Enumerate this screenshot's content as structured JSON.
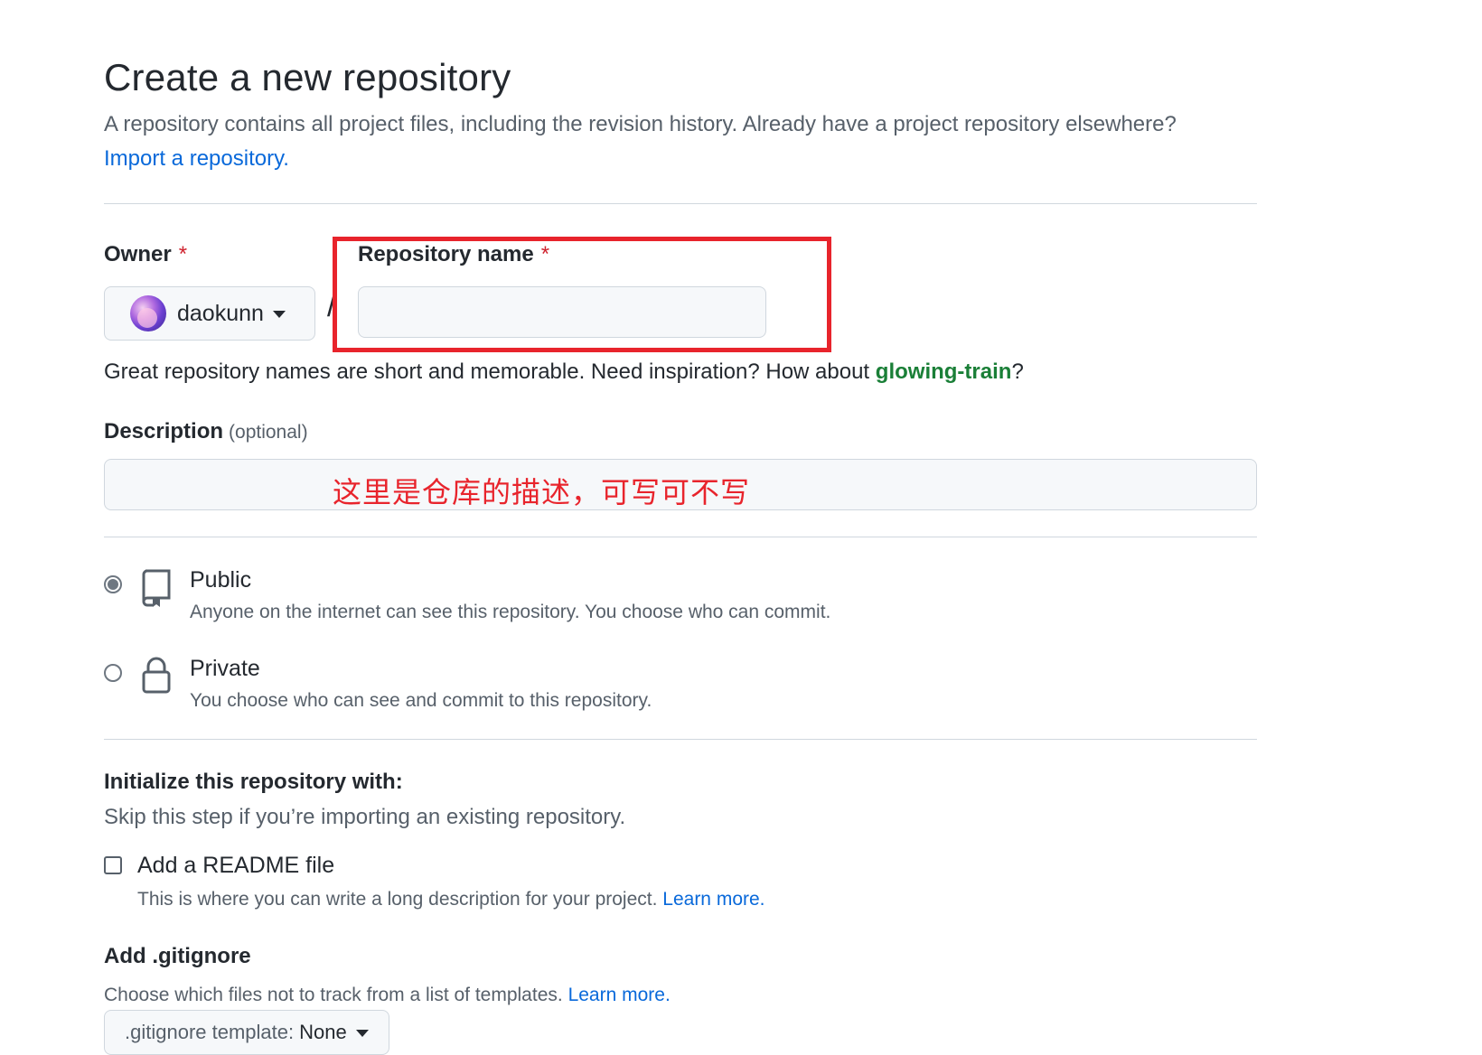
{
  "header": {
    "title": "Create a new repository",
    "subtitle": "A repository contains all project files, including the revision history. Already have a project repository elsewhere?",
    "import_link": "Import a repository."
  },
  "owner": {
    "label": "Owner",
    "required_mark": "*",
    "name": "daokunn",
    "avatar_icon": "user-avatar",
    "separator": "/"
  },
  "repo_name": {
    "label": "Repository name",
    "required_mark": "*",
    "value": "",
    "placeholder": ""
  },
  "name_hint": {
    "text": "Great repository names are short and memorable. Need inspiration? How about ",
    "suggestion": "glowing-train",
    "end": "?"
  },
  "description": {
    "label": "Description",
    "optional": "(optional)",
    "value": "",
    "annotation": "这里是仓库的描述，可写可不写"
  },
  "visibility": {
    "options": [
      {
        "title": "Public",
        "desc": "Anyone on the internet can see this repository. You choose who can commit.",
        "icon": "repo-icon",
        "selected": true
      },
      {
        "title": "Private",
        "desc": "You choose who can see and commit to this repository.",
        "icon": "lock-icon",
        "selected": false
      }
    ]
  },
  "initialize": {
    "title": "Initialize this repository with:",
    "subtitle": "Skip this step if you’re importing an existing repository.",
    "readme": {
      "label": "Add a README file",
      "desc": "This is where you can write a long description for your project.",
      "learn_more": "Learn more.",
      "checked": false
    }
  },
  "gitignore": {
    "title": "Add .gitignore",
    "desc": "Choose which files not to track from a list of templates.",
    "learn_more": "Learn more.",
    "select_label": ".gitignore template:",
    "select_value": "None"
  },
  "colors": {
    "link": "#0969da",
    "required": "#cf222e",
    "suggestion": "#1a7f37",
    "annotation": "#e8242c"
  }
}
